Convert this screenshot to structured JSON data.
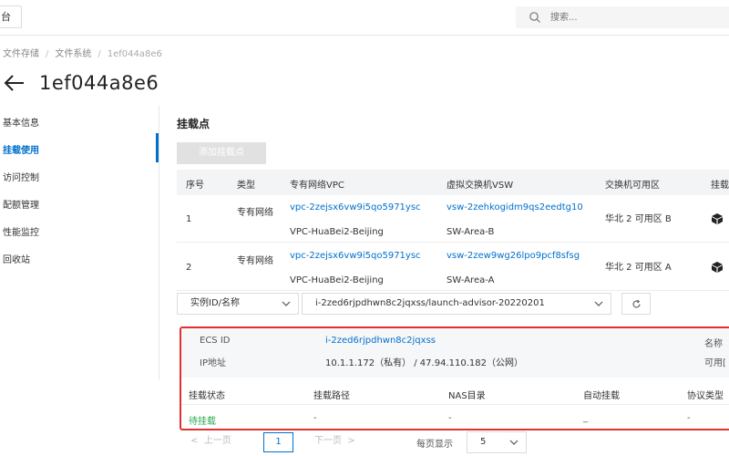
{
  "topbar": {
    "left_label": "台",
    "search_placeholder": "搜索..."
  },
  "breadcrumb": {
    "items": [
      "文件存储",
      "文件系统",
      "1ef044a8e6"
    ]
  },
  "page_title": "1ef044a8e6",
  "sidebar": {
    "items": [
      {
        "label": "基本信息",
        "active": false
      },
      {
        "label": "挂载使用",
        "active": true
      },
      {
        "label": "访问控制",
        "active": false
      },
      {
        "label": "配额管理",
        "active": false
      },
      {
        "label": "性能监控",
        "active": false
      },
      {
        "label": "回收站",
        "active": false
      }
    ]
  },
  "mount_section": {
    "title": "挂载点",
    "add_button": "添加挂载点",
    "columns": [
      "序号",
      "类型",
      "专有网络VPC",
      "虚拟交换机VSW",
      "交换机可用区",
      "挂载"
    ],
    "rows": [
      {
        "index": "1",
        "type": "专有网络",
        "vpc_id": "vpc-2zejsx6vw9i5qo5971ysc",
        "vpc_name": "VPC-HuaBei2-Beijing",
        "vsw_id": "vsw-2zehkogidm9qs2eedtg10",
        "vsw_name": "SW-Area-B",
        "zone": "华北 2 可用区 B"
      },
      {
        "index": "2",
        "type": "专有网络",
        "vpc_id": "vpc-2zejsx6vw9i5qo5971ysc",
        "vpc_name": "VPC-HuaBei2-Beijing",
        "vsw_id": "vsw-2zew9wg26lpo9pcf8sfsg",
        "vsw_name": "SW-Area-A",
        "zone": "华北 2 可用区 A"
      }
    ]
  },
  "filter": {
    "field_label": "实例ID/名称",
    "instance_value": "i-2zed6rjpdhwn8c2jqxss/launch-advisor-20220201"
  },
  "detail": {
    "ecs_id_label": "ECS ID",
    "ecs_id_value": "i-2zed6rjpdhwn8c2jqxss",
    "ip_label": "IP地址",
    "ip_value": "10.1.1.172（私有） / 47.94.110.182（公网）",
    "name_label": "名称",
    "zone_label": "可用[",
    "columns": [
      "挂载状态",
      "挂载路径",
      "NAS目录",
      "自动挂载",
      "协议类型"
    ],
    "row": {
      "status": "待挂载",
      "path": "-",
      "nas_dir": "-",
      "auto_mount": "_",
      "protocol": "-"
    }
  },
  "pagination": {
    "prev": "上一页",
    "current_page": "1",
    "next": "下一页",
    "per_page_label": "每页显示",
    "per_page_value": "5"
  },
  "colors": {
    "accent": "#0070cc",
    "highlight_border": "#e0312f",
    "status_pending": "#2aa952"
  }
}
